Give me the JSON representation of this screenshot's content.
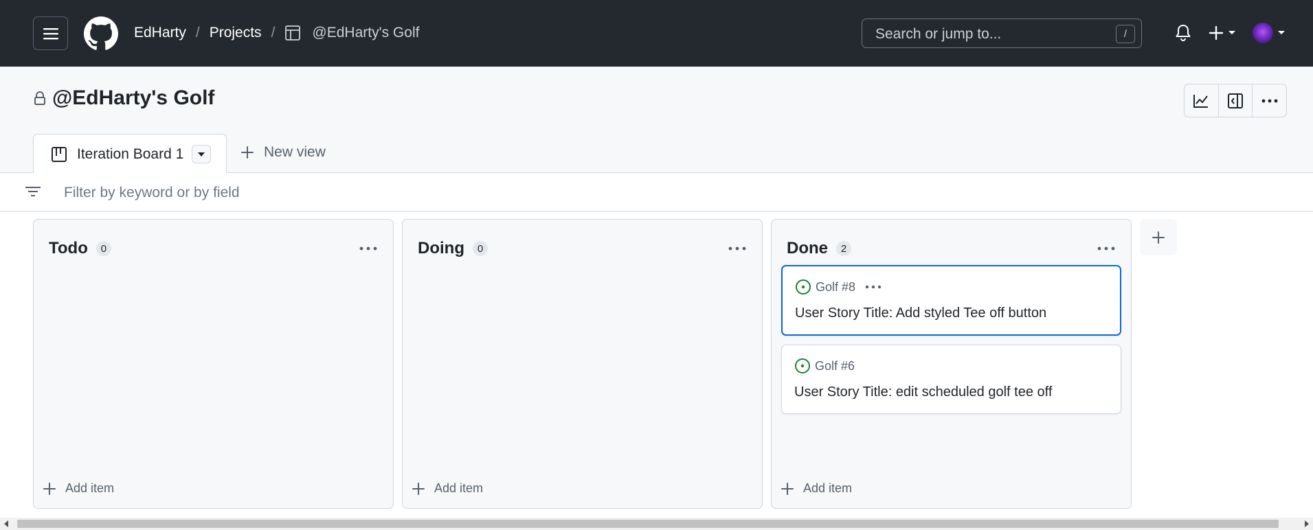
{
  "header": {
    "breadcrumbs": [
      "EdHarty",
      "Projects",
      "@EdHarty's Golf"
    ],
    "separator": "/",
    "search_placeholder": "Search or jump to...",
    "search_shortcut": "/"
  },
  "project": {
    "title": "@EdHarty's Golf",
    "tabs": [
      {
        "label": "Iteration Board 1"
      }
    ],
    "new_view_label": "New view",
    "filter_placeholder": "Filter by keyword or by field"
  },
  "columns": [
    {
      "name": "Todo",
      "count": "0",
      "add_label": "Add item",
      "cards": []
    },
    {
      "name": "Doing",
      "count": "0",
      "add_label": "Add item",
      "cards": []
    },
    {
      "name": "Done",
      "count": "2",
      "add_label": "Add item",
      "cards": [
        {
          "ref": "Golf #8",
          "title": "User Story Title: Add styled Tee off button",
          "selected": true
        },
        {
          "ref": "Golf #6",
          "title": "User Story Title: edit scheduled golf tee off",
          "selected": false
        }
      ]
    }
  ],
  "icons": {
    "menu": "hamburger-icon",
    "logo": "github-logo-icon",
    "project": "table-icon",
    "notifications": "bell-icon",
    "create": "plus-icon",
    "lock": "lock-icon",
    "insights": "graph-icon",
    "side_panel": "sidebar-icon",
    "more": "kebab-horizontal-icon",
    "board": "board-icon",
    "filter": "filter-icon",
    "issue_open": "issue-opened-icon"
  },
  "colors": {
    "header_bg": "#24292f",
    "accent_blue": "#0969da",
    "issue_open_green": "#1a7f37",
    "avatar_purple": "#6f2dbd"
  }
}
